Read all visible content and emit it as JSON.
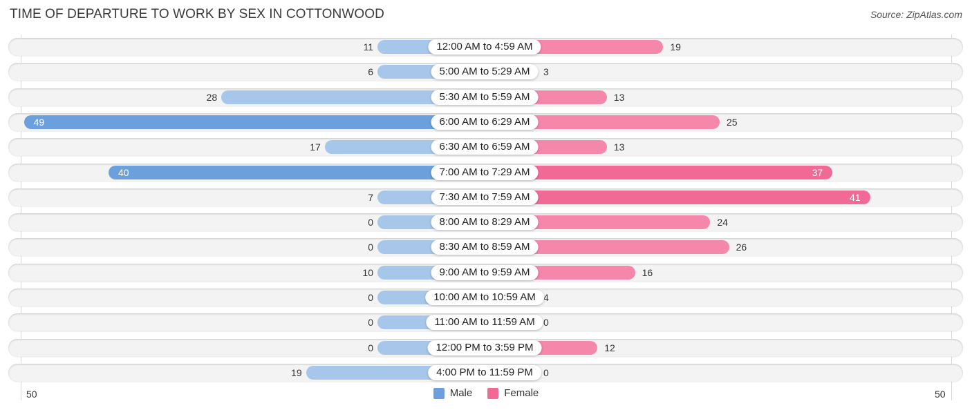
{
  "header": {
    "title": "TIME OF DEPARTURE TO WORK BY SEX IN COTTONWOOD",
    "source": "Source: ZipAtlas.com"
  },
  "colors": {
    "male": "#6ba0dc",
    "male_light": "#a7c7ea",
    "female": "#f06a95",
    "female_light": "#f5a9c2"
  },
  "chart_data": {
    "type": "bar",
    "orientation": "horizontal-diverging",
    "title": "TIME OF DEPARTURE TO WORK BY SEX IN COTTONWOOD",
    "categories": [
      "12:00 AM to 4:59 AM",
      "5:00 AM to 5:29 AM",
      "5:30 AM to 5:59 AM",
      "6:00 AM to 6:29 AM",
      "6:30 AM to 6:59 AM",
      "7:00 AM to 7:29 AM",
      "7:30 AM to 7:59 AM",
      "8:00 AM to 8:29 AM",
      "8:30 AM to 8:59 AM",
      "9:00 AM to 9:59 AM",
      "10:00 AM to 10:59 AM",
      "11:00 AM to 11:59 AM",
      "12:00 PM to 3:59 PM",
      "4:00 PM to 11:59 PM"
    ],
    "series": [
      {
        "name": "Male",
        "values": [
          11,
          6,
          28,
          49,
          17,
          40,
          7,
          0,
          0,
          10,
          0,
          0,
          0,
          19
        ]
      },
      {
        "name": "Female",
        "values": [
          19,
          3,
          13,
          25,
          13,
          37,
          41,
          24,
          26,
          16,
          4,
          0,
          12,
          0
        ]
      }
    ],
    "axis": {
      "left_label": "50",
      "right_label": "50",
      "range": [
        -50,
        50
      ]
    },
    "legend": {
      "position": "bottom-center",
      "entries": [
        "Male",
        "Female"
      ]
    },
    "grid": false
  }
}
